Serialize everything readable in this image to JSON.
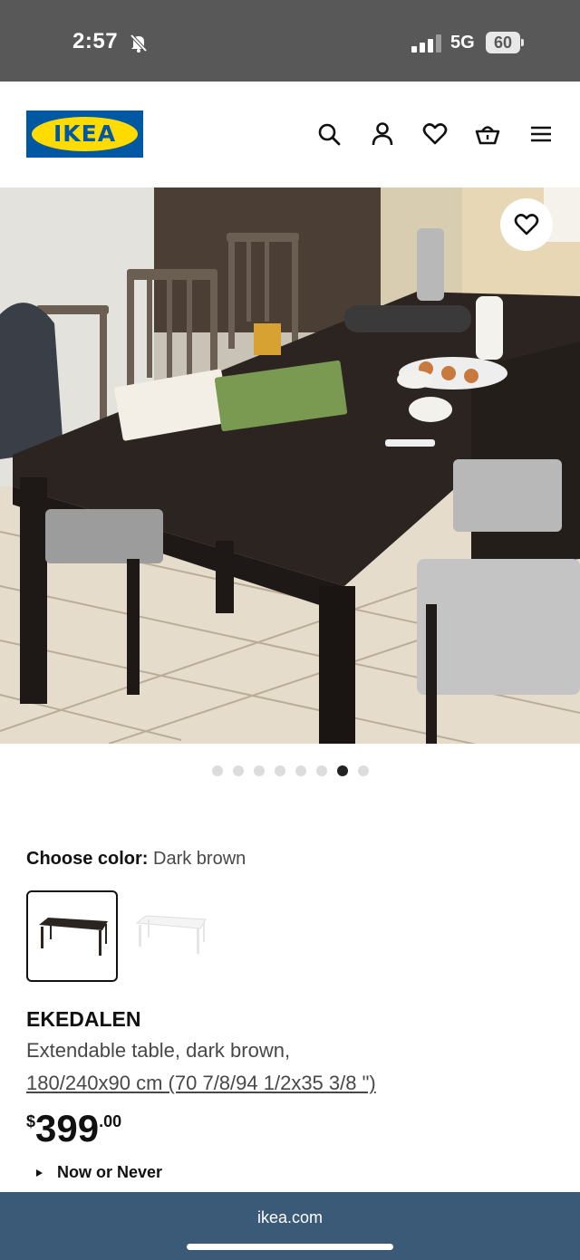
{
  "status_bar": {
    "time": "2:57",
    "network": "5G",
    "battery": "60"
  },
  "header": {
    "logo_text": "IKEA",
    "icons": [
      "search-icon",
      "account-icon",
      "favorites-icon",
      "cart-icon",
      "menu-icon"
    ]
  },
  "gallery": {
    "slide_count": 8,
    "active_index": 6
  },
  "color_choice": {
    "label": "Choose color:",
    "value": "Dark brown",
    "swatches": [
      {
        "name": "Dark brown",
        "color": "#2b2522",
        "selected": true
      },
      {
        "name": "White",
        "color": "#f4f4f4",
        "selected": false
      }
    ]
  },
  "product": {
    "name": "EKEDALEN",
    "description": "Extendable table, dark brown,",
    "size": "180/240x90 cm (70 7/8/94 1/2x35 3/8 \")",
    "price": {
      "currency": "$",
      "integer": "399",
      "decimals": ".00"
    },
    "promo": "Now or Never"
  },
  "browser": {
    "url": "ikea.com"
  },
  "colors": {
    "brand_blue": "#0058a3",
    "brand_yellow": "#ffdb00",
    "status_bar": "#585858",
    "url_bar": "#3a5a78"
  }
}
